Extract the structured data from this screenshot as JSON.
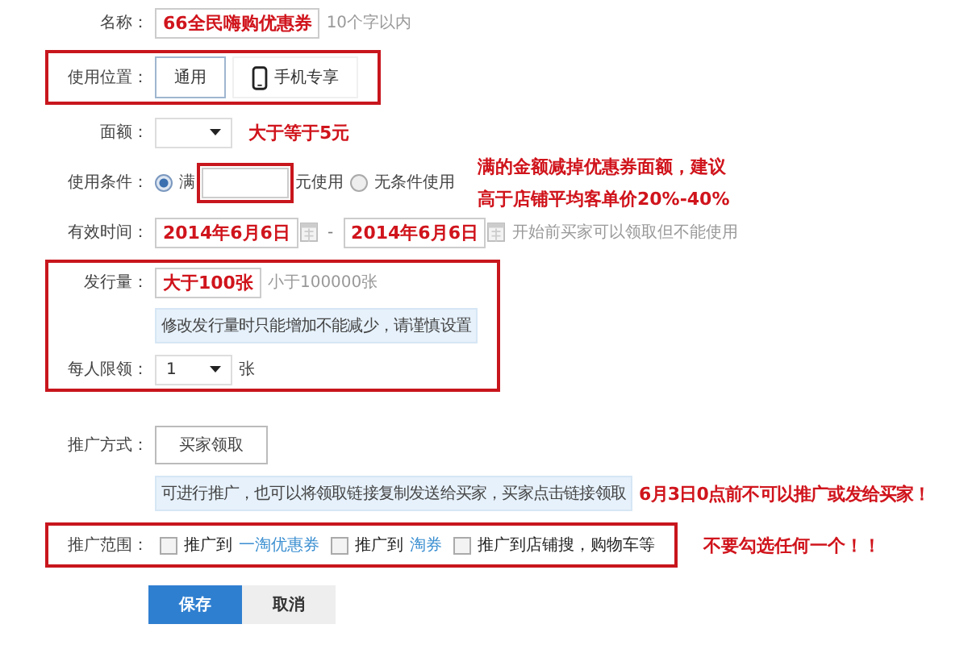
{
  "form": [
    {
      "kind": "text",
      "label": "名称：",
      "value": "66全民嗨购优惠券",
      "hint": "10个字以内"
    },
    {
      "kind": "group",
      "outlined": true,
      "rows": [
        {
          "kind": "segmented",
          "label": "使用位置：",
          "options": [
            {
              "label": "通用",
              "kind": "plain",
              "selected": true
            },
            {
              "label": "手机专享",
              "kind": "phone",
              "selected": false
            }
          ]
        }
      ]
    },
    {
      "kind": "select",
      "label": "面额：",
      "note": "大于等于5元"
    },
    {
      "kind": "condition",
      "label": "使用条件：",
      "prefix": "满",
      "suffix": "元使用",
      "input_outlined": true,
      "selected": true,
      "alt": {
        "label": "无条件使用",
        "selected": false
      },
      "note": [
        "满的金额减掉优惠券面额，建议",
        "高于店铺平均客单价20%-40%"
      ]
    },
    {
      "kind": "date_range",
      "label": "有效时间：",
      "start": "2014年6月6日",
      "separator": "-",
      "end": "2014年6月6日",
      "hint": "开始前买家可以领取但不能使用"
    },
    {
      "kind": "group",
      "outlined": true,
      "rows": [
        {
          "kind": "text",
          "label": "发行量：",
          "value": "大于100张",
          "hint": "小于100000张"
        },
        {
          "kind": "info",
          "text": "修改发行量时只能增加不能减少，请谨慎设置"
        },
        {
          "kind": "select",
          "label": "每人限领：",
          "value": "1",
          "unit": "张"
        }
      ]
    },
    {
      "kind": "button_choice",
      "label": "推广方式：",
      "button": "买家领取"
    },
    {
      "kind": "info",
      "text": "可进行推广，也可以将领取链接复制发送给买家，买家点击链接领取",
      "note": "6月3日0点前不可以推广或发给买家！"
    },
    {
      "kind": "group",
      "outlined": true,
      "note": "不要勾选任何一个！！",
      "rows": [
        {
          "kind": "checks",
          "label": "推广范围：",
          "options": [
            {
              "text": "推广到",
              "link": "一淘优惠券",
              "checked": false
            },
            {
              "text": "推广到",
              "link": "淘券",
              "checked": false
            },
            {
              "text": "推广到店铺搜，购物车等",
              "checked": false
            }
          ]
        }
      ]
    },
    {
      "kind": "actions",
      "buttons": [
        {
          "label": "保存",
          "primary": true
        },
        {
          "label": "取消",
          "primary": false
        }
      ]
    }
  ]
}
